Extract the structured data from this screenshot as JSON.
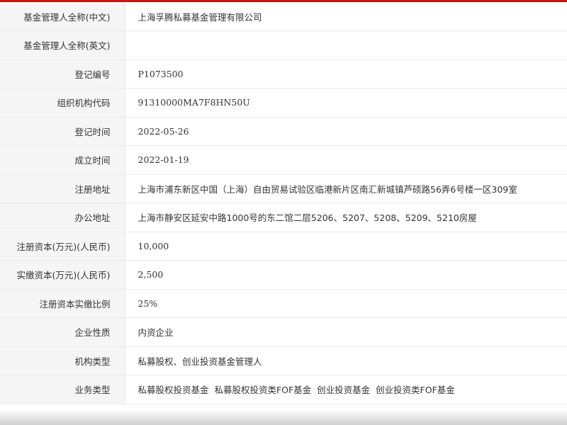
{
  "colors": {
    "accent": "#c8131a",
    "label_bg": "#f5f5f5",
    "border": "#eaeaea",
    "text": "#333333"
  },
  "rows": [
    {
      "label": "基金管理人全称(中文)",
      "value": "上海孚腾私募基金管理有限公司"
    },
    {
      "label": "基金管理人全称(英文)",
      "value": ""
    },
    {
      "label": "登记编号",
      "value": "P1073500"
    },
    {
      "label": "组织机构代码",
      "value": "91310000MA7F8HN50U"
    },
    {
      "label": "登记时间",
      "value": "2022-05-26"
    },
    {
      "label": "成立时间",
      "value": "2022-01-19"
    },
    {
      "label": "注册地址",
      "value": "上海市浦东新区中国（上海）自由贸易试验区临港新片区南汇新城镇芦硕路56弄6号楼一区309室"
    },
    {
      "label": "办公地址",
      "value": "上海市静安区延安中路1000号的东二馆二层5206、5207、5208、5209、5210房屋"
    },
    {
      "label": "注册资本(万元)(人民币)",
      "value": "10,000"
    },
    {
      "label": "实缴资本(万元)(人民币)",
      "value": "2,500"
    },
    {
      "label": "注册资本实缴比例",
      "value": "25%"
    },
    {
      "label": "企业性质",
      "value": "内资企业"
    },
    {
      "label": "机构类型",
      "value": "私募股权、创业投资基金管理人"
    },
    {
      "label": "业务类型",
      "value": "私募股权投资基金  私募股权投资类FOF基金  创业投资基金  创业投资类FOF基金"
    }
  ]
}
